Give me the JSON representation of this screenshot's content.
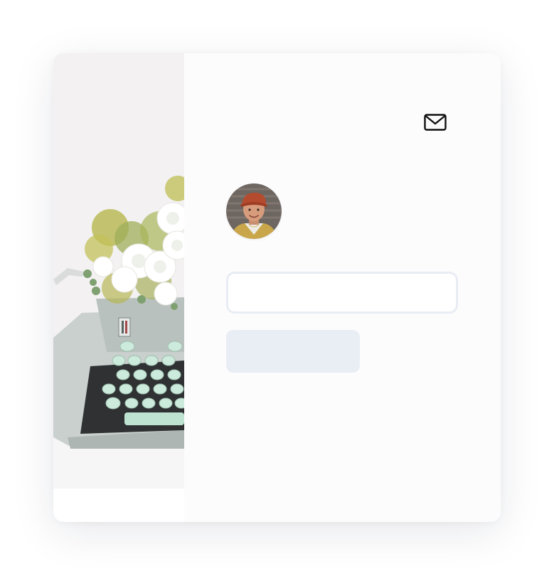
{
  "header": {
    "mail_icon": "envelope-icon"
  },
  "profile": {
    "avatar_icon": "user-avatar-photo"
  },
  "form": {
    "email_value": "",
    "email_placeholder": "",
    "submit_label": ""
  },
  "hero": {
    "image": "typewriter-with-flowers-photo"
  },
  "colors": {
    "card_background": "#fcfcfd",
    "input_border": "#e8ecf3",
    "button_background": "#e9edf4",
    "icon_stroke": "#111111"
  }
}
